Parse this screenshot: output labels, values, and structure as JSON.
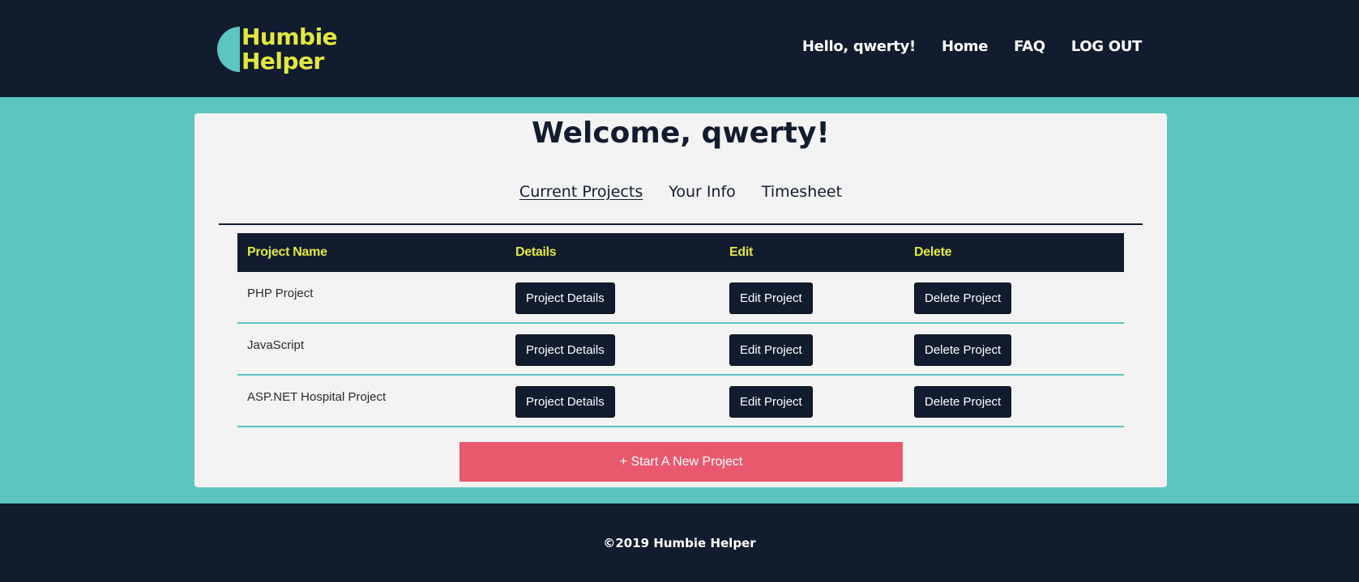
{
  "header": {
    "logo": {
      "line1": "Humbie",
      "line2": "Helper"
    },
    "greeting": "Hello, qwerty!",
    "nav": [
      "Home",
      "FAQ",
      "LOG OUT"
    ]
  },
  "main": {
    "welcome": "Welcome, qwerty!",
    "tabs": [
      {
        "label": "Current Projects",
        "active": true
      },
      {
        "label": "Your Info",
        "active": false
      },
      {
        "label": "Timesheet",
        "active": false
      }
    ],
    "table": {
      "headers": [
        "Project Name",
        "Details",
        "Edit",
        "Delete"
      ],
      "rows": [
        {
          "name": "PHP Project",
          "details": "Project Details",
          "edit": "Edit Project",
          "delete": "Delete Project"
        },
        {
          "name": "JavaScript",
          "details": "Project Details",
          "edit": "Edit Project",
          "delete": "Delete Project"
        },
        {
          "name": "ASP.NET Hospital Project",
          "details": "Project Details",
          "edit": "Edit Project",
          "delete": "Delete Project"
        }
      ]
    },
    "new_project_button": "+ Start A New Project"
  },
  "footer": {
    "copyright": "©2019 Humbie Helper"
  },
  "colors": {
    "navy": "#111c2e",
    "teal": "#5bc5c0",
    "yellow": "#e3e840",
    "pink": "#e8596e",
    "card": "#f3f3f3"
  }
}
